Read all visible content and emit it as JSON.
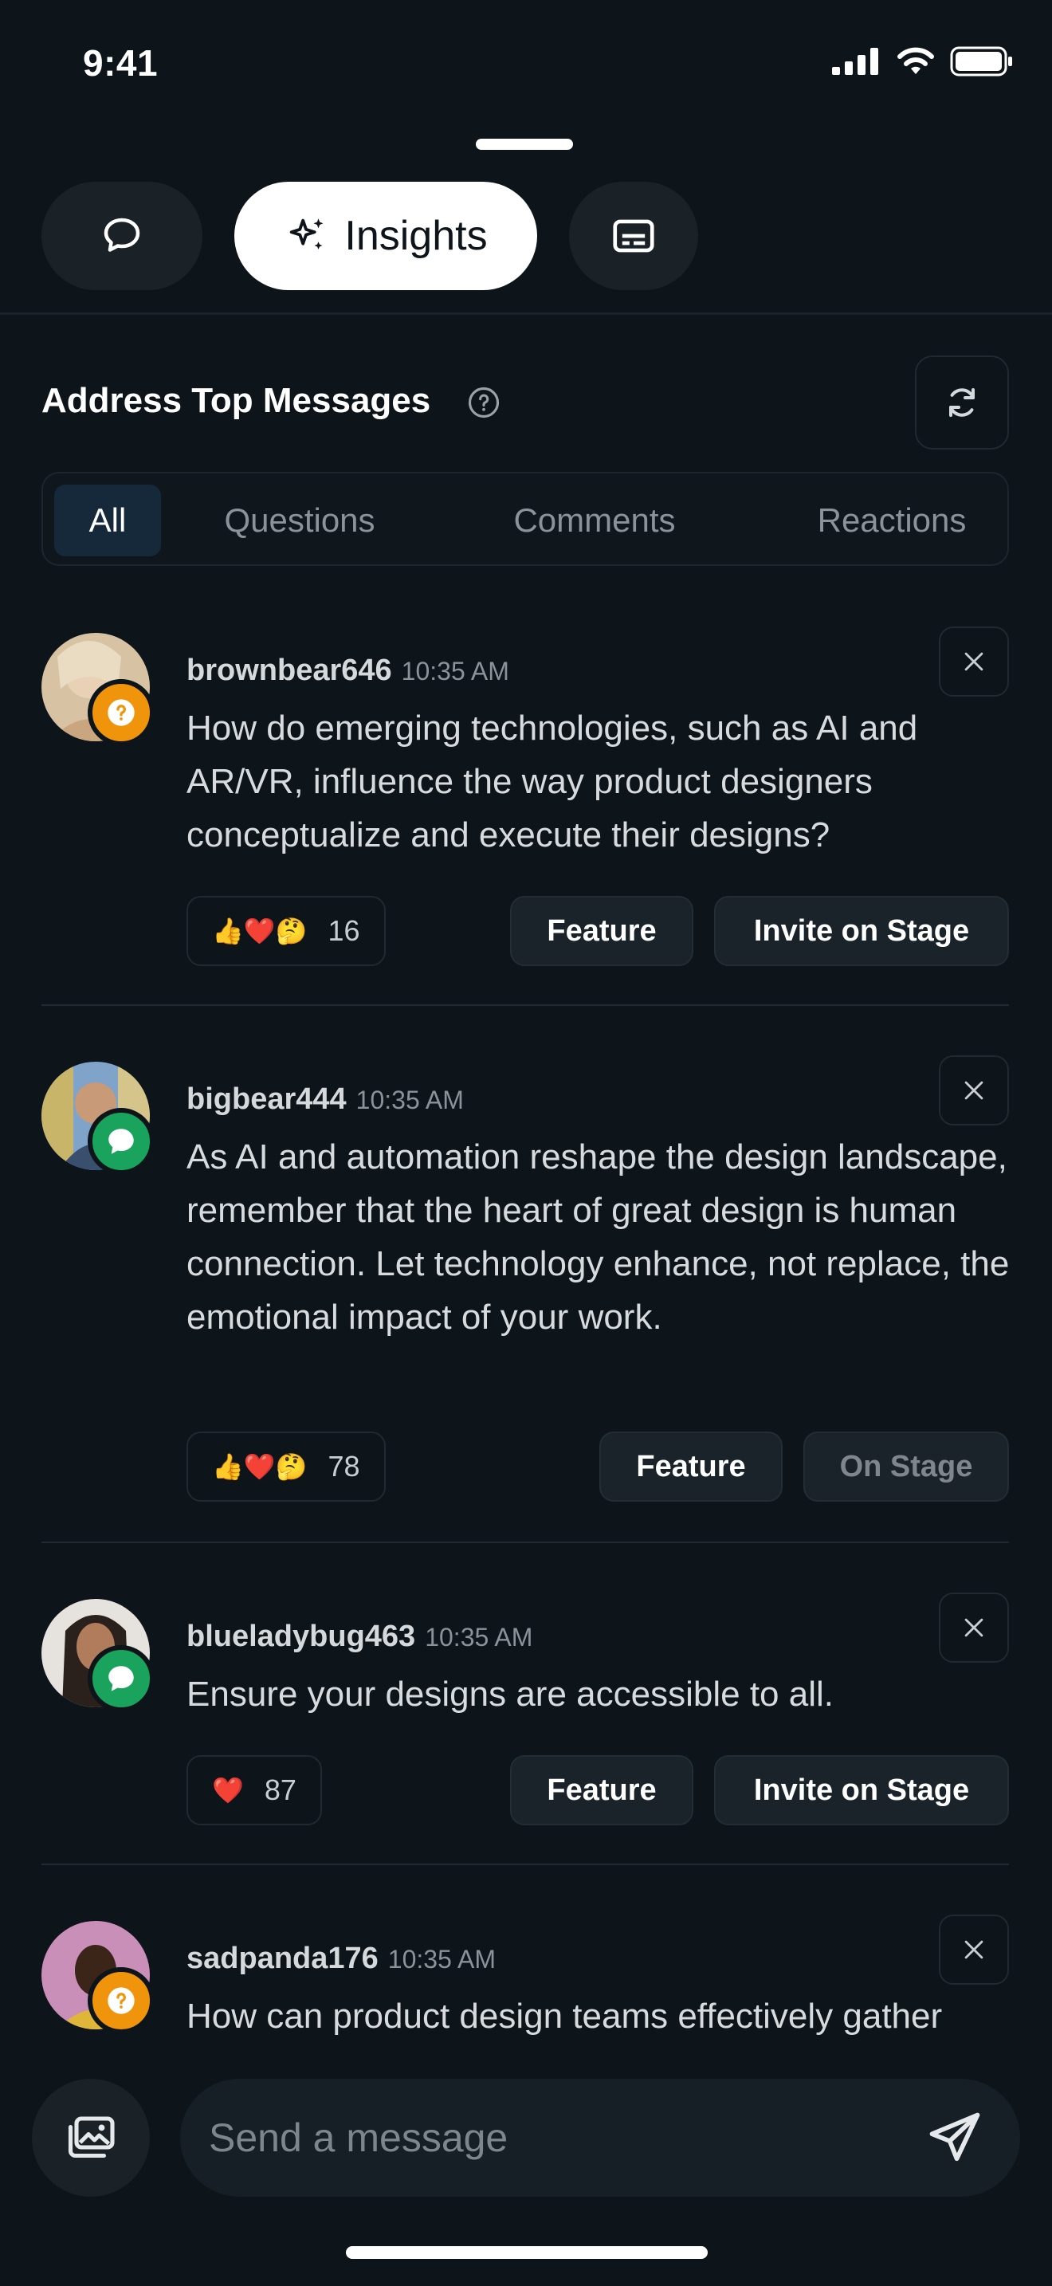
{
  "status_bar": {
    "time": "9:41"
  },
  "top_tabs": {
    "insights_label": "Insights"
  },
  "section": {
    "title": "Address Top Messages"
  },
  "filters": {
    "all": "All",
    "questions": "Questions",
    "comments": "Comments",
    "reactions": "Reactions"
  },
  "messages": [
    {
      "user": "brownbear646",
      "time": "10:35 AM",
      "text": "How do emerging technologies, such as AI and AR/VR, influence the way product designers conceptualize and execute their designs?",
      "type": "question",
      "emojis": "👍❤️🤔",
      "reaction_count": "16",
      "feature_label": "Feature",
      "stage_label": "Invite on Stage"
    },
    {
      "user": "bigbear444",
      "time": "10:35 AM",
      "text": "As AI and automation reshape the design landscape, remember that the heart of great design is human connection. Let technology enhance, not replace, the emotional impact of your work.",
      "type": "comment",
      "emojis": "👍❤️🤔",
      "reaction_count": "78",
      "feature_label": "Feature",
      "stage_label": "On Stage"
    },
    {
      "user": "blueladybug463",
      "time": "10:35 AM",
      "text": "Ensure your designs are accessible to all.",
      "type": "comment",
      "emojis": "❤️",
      "reaction_count": "87",
      "feature_label": "Feature",
      "stage_label": "Invite on Stage"
    },
    {
      "user": "sadpanda176",
      "time": "10:35 AM",
      "text": "How can product design teams effectively gather",
      "type": "question"
    }
  ],
  "composer": {
    "placeholder": "Send a message"
  },
  "colors": {
    "question_badge": "#f0940c",
    "comment_badge": "#1aa35c",
    "background": "#0d141a"
  }
}
